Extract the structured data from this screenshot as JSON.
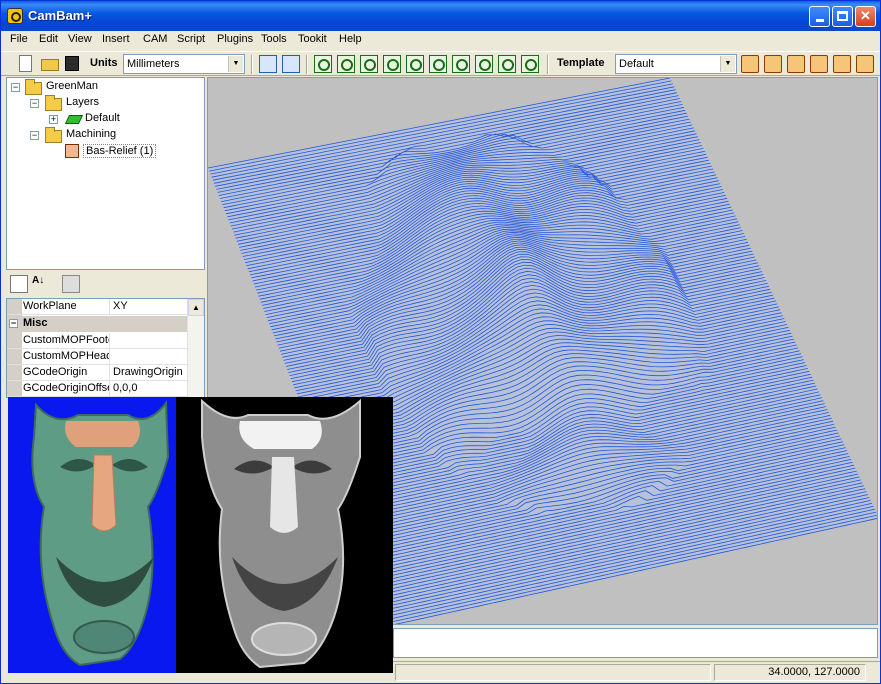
{
  "window": {
    "title": "CamBam+"
  },
  "menu": [
    "File",
    "Edit",
    "View",
    "Insert",
    "CAM",
    "Script",
    "Plugins",
    "Tools",
    "Tookit",
    "Help"
  ],
  "toolbar": {
    "units_label": "Units",
    "units_value": "Millimeters",
    "template_label": "Template",
    "template_value": "Default"
  },
  "tree": {
    "root": "GreenMan",
    "layers": "Layers",
    "default_layer": "Default",
    "machining": "Machining",
    "mop": "Bas-Relief (1)"
  },
  "properties": {
    "header_name": "WorkPlane",
    "header_value": "XY",
    "category": "Misc",
    "rows": [
      {
        "name": "CustomMOPFooter",
        "value": ""
      },
      {
        "name": "CustomMOPHeader",
        "value": ""
      },
      {
        "name": "GCodeOrigin",
        "value": "DrawingOrigin"
      },
      {
        "name": "GCodeOriginOffset",
        "value": "0,0,0"
      }
    ]
  },
  "status": {
    "coords": "34.0000, 127.0000"
  },
  "colors": {
    "toolpath": "#2255dd",
    "viewport_bg": "#c0c0c0",
    "stock_fill": "#b7c2d9"
  }
}
